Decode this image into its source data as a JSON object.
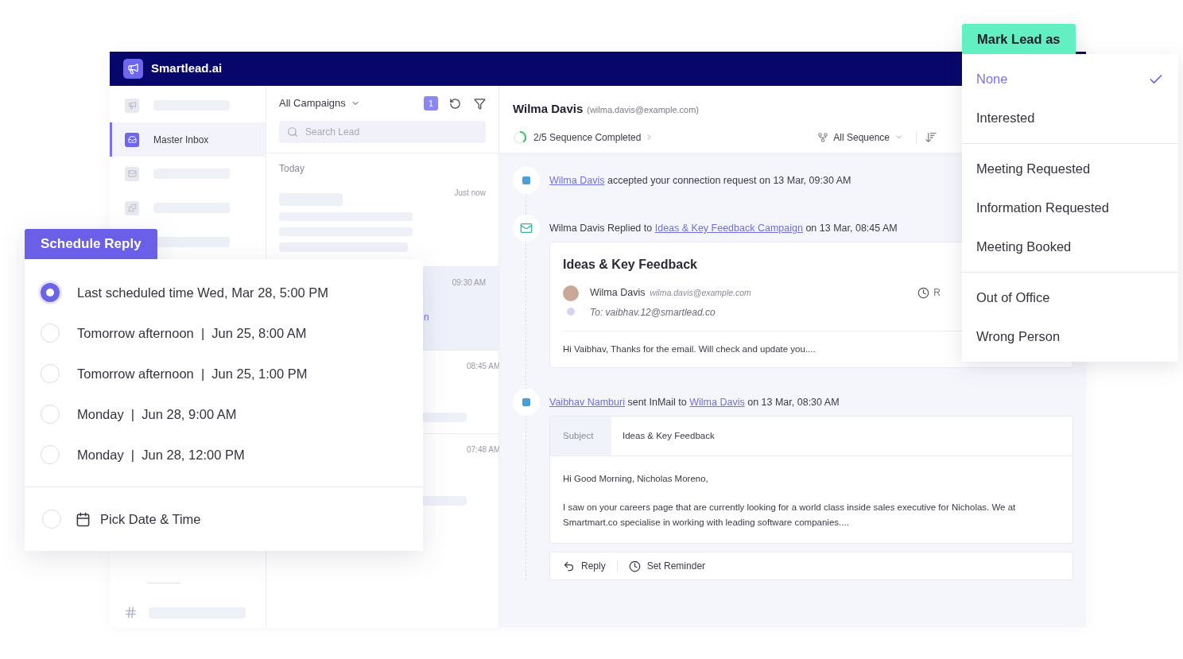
{
  "app": {
    "brand": "Smartlead.ai"
  },
  "sidebar": {
    "items": [
      {
        "kind": "skeleton",
        "selected": false
      },
      {
        "kind": "entry",
        "label": "Master Inbox",
        "selected": true
      },
      {
        "kind": "skeleton",
        "selected": false
      },
      {
        "kind": "skeleton",
        "selected": false
      },
      {
        "kind": "skeleton",
        "selected": false
      }
    ]
  },
  "lead_list": {
    "filter": "All Campaigns",
    "badge": "1",
    "search": {
      "placeholder": "Search Lead"
    },
    "group": "Today",
    "items": [
      {
        "time": "Just now",
        "selected": false
      },
      {
        "time": "09:30 AM",
        "preview": "n",
        "selected": true
      },
      {
        "time": "08:45 AM",
        "selected": false
      },
      {
        "time": "07:48 AM",
        "selected": false
      }
    ]
  },
  "conversation": {
    "name": "Wilma Davis",
    "email": "(wilma.davis@example.com)",
    "progress": {
      "label": "2/5 Sequence Completed",
      "level": 0.4
    },
    "sequence_filter": "All Sequence",
    "events": [
      {
        "kind": "connection",
        "parts": [
          {
            "text": "Wilma Davis",
            "link": true
          },
          {
            "text": "accepted your connection request on 13 Mar, 09:30 AM",
            "link": false
          }
        ]
      },
      {
        "kind": "reply",
        "parts": [
          {
            "text": "Wilma Davis Replied to",
            "link": false
          },
          {
            "text": "Ideas & Key Feedback Campaign",
            "link": true
          },
          {
            "text": "on 13 Mar, 08:45 AM",
            "link": false
          }
        ],
        "card": {
          "title": "Ideas & Key Feedback",
          "sender": "Wilma Davis",
          "sender_email": "wilma.davis@example.com",
          "to": "To: vaibhav.12@smartlead.co",
          "reminder": "R",
          "body": "Hi Vaibhav, Thanks for the email. Will check and update you...."
        }
      },
      {
        "kind": "inmail",
        "parts": [
          {
            "text": "Vaibhav Namburi",
            "link": true
          },
          {
            "text": "sent InMail to",
            "link": false
          },
          {
            "text": "Wilma Davis",
            "link": true
          },
          {
            "text": "on 13 Mar, 08:30 AM",
            "link": false
          }
        ],
        "card": {
          "subject_label": "Subject",
          "subject": "Ideas & Key Feedback",
          "greeting": "Hi Good Morning, Nicholas Moreno,",
          "body": "I saw on your careers page that are currently looking for a world class inside sales executive for Nicholas. We at Smartmart.co specialise in working with leading software companies....",
          "actions": [
            {
              "kind": "reply",
              "label": "Reply"
            },
            {
              "kind": "reminder",
              "label": "Set Reminder"
            }
          ]
        }
      }
    ]
  },
  "schedule_reply": {
    "title": "Schedule Reply",
    "options": [
      {
        "label": "Last scheduled time Wed, Mar 28, 5:00 PM",
        "selected": true
      },
      {
        "label": "Tomorrow afternoon  |  Jun 25, 8:00 AM",
        "selected": false
      },
      {
        "label": "Tomorrow afternoon  |  Jun 25, 1:00 PM",
        "selected": false
      },
      {
        "label": "Monday  |  Jun 28, 9:00 AM",
        "selected": false
      },
      {
        "label": "Monday  |  Jun 28, 12:00 PM",
        "selected": false
      }
    ],
    "custom": {
      "label": "Pick Date & Time",
      "selected": false
    }
  },
  "mark_lead": {
    "title": "Mark Lead as",
    "groups": [
      {
        "items": [
          {
            "label": "None",
            "selected": true
          },
          {
            "label": "Interested",
            "selected": false
          }
        ]
      },
      {
        "items": [
          {
            "label": "Meeting Requested",
            "selected": false
          },
          {
            "label": "Information Requested",
            "selected": false
          },
          {
            "label": "Meeting Booked",
            "selected": false
          }
        ]
      },
      {
        "items": [
          {
            "label": "Out of Office",
            "selected": false
          },
          {
            "label": "Wrong Person",
            "selected": false
          }
        ]
      }
    ]
  }
}
